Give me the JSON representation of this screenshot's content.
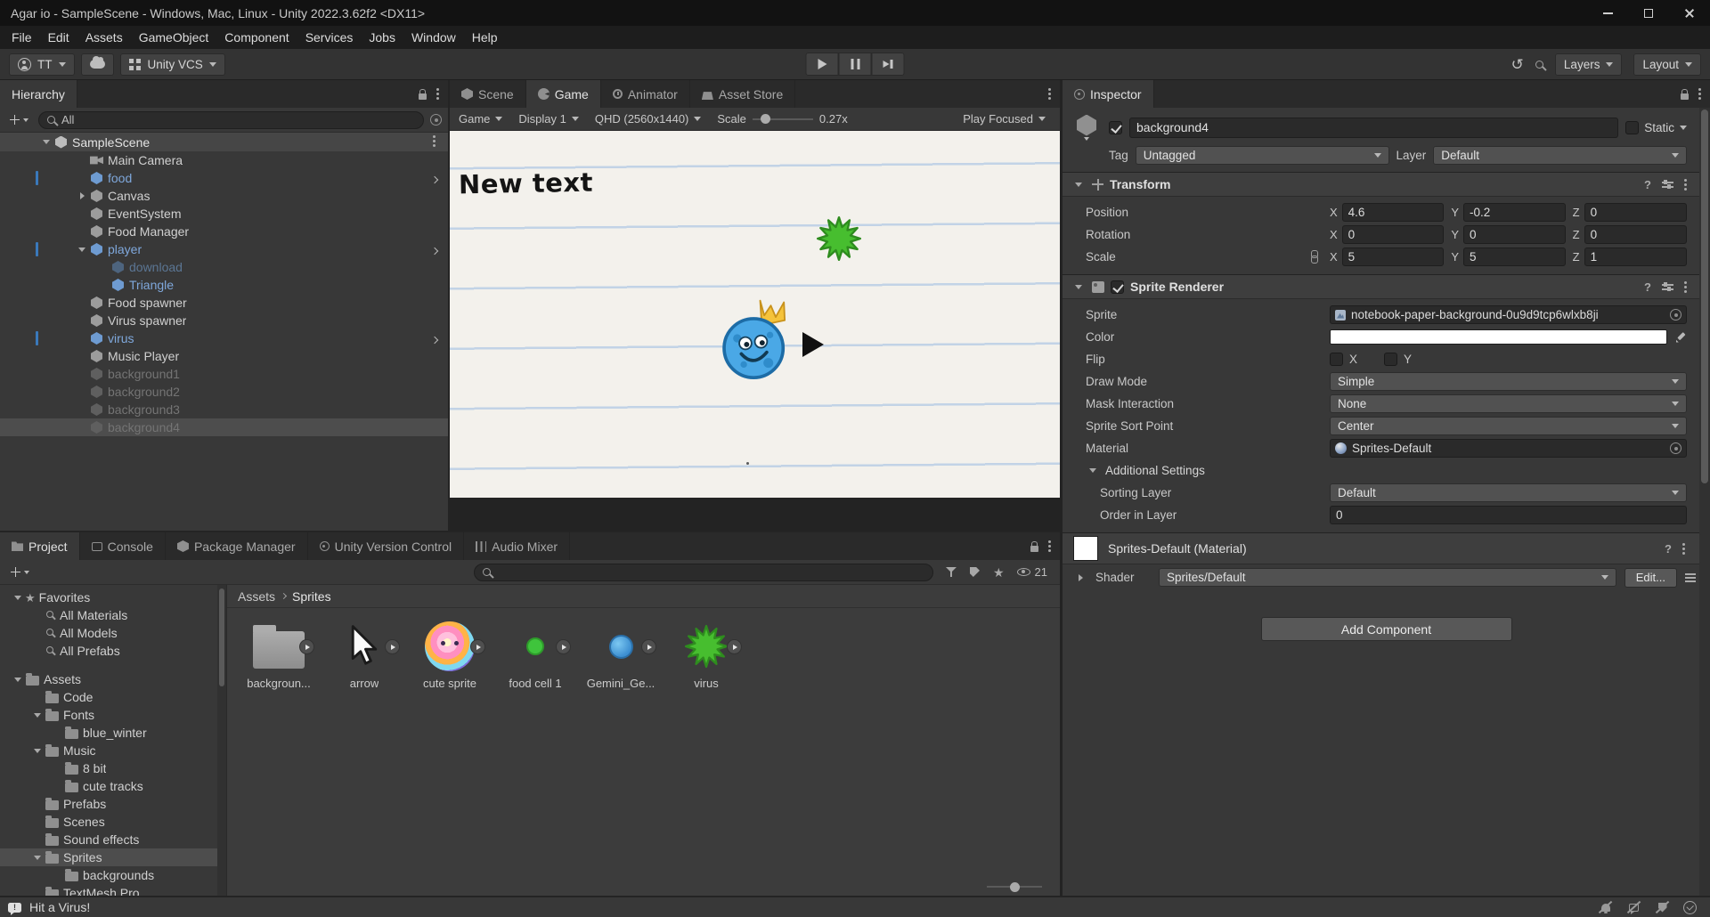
{
  "window": {
    "title": "Agar io - SampleScene - Windows, Mac, Linux - Unity 2022.3.62f2 <DX11>",
    "menus": [
      "File",
      "Edit",
      "Assets",
      "GameObject",
      "Component",
      "Services",
      "Jobs",
      "Window",
      "Help"
    ]
  },
  "toolbar": {
    "account": "TT",
    "vcs": "Unity VCS",
    "layers": "Layers",
    "layout": "Layout"
  },
  "hierarchy": {
    "tab": "Hierarchy",
    "search_value": "All",
    "scene_name": "SampleScene",
    "items": [
      {
        "label": "Main Camera",
        "level": 1,
        "kind": "camera"
      },
      {
        "label": "food",
        "level": 1,
        "kind": "prefab",
        "prefab_chevron": true,
        "accent": true
      },
      {
        "label": "Canvas",
        "level": 1,
        "kind": "go",
        "arrow": "collapsed"
      },
      {
        "label": "EventSystem",
        "level": 1,
        "kind": "go"
      },
      {
        "label": "Food Manager",
        "level": 1,
        "kind": "go"
      },
      {
        "label": "player",
        "level": 1,
        "kind": "prefab",
        "arrow": "expanded",
        "prefab_chevron": true,
        "accent": true
      },
      {
        "label": "download",
        "level": 2,
        "kind": "prefab-disabled"
      },
      {
        "label": "Triangle",
        "level": 2,
        "kind": "prefab"
      },
      {
        "label": "Food spawner",
        "level": 1,
        "kind": "go"
      },
      {
        "label": "Virus spawner",
        "level": 1,
        "kind": "go"
      },
      {
        "label": "virus",
        "level": 1,
        "kind": "prefab",
        "prefab_chevron": true,
        "accent": true
      },
      {
        "label": "Music Player",
        "level": 1,
        "kind": "go"
      },
      {
        "label": "background1",
        "level": 1,
        "kind": "disabled"
      },
      {
        "label": "background2",
        "level": 1,
        "kind": "disabled"
      },
      {
        "label": "background3",
        "level": 1,
        "kind": "disabled"
      },
      {
        "label": "background4",
        "level": 1,
        "kind": "disabled",
        "selected": true
      }
    ]
  },
  "center": {
    "tabs": [
      "Scene",
      "Game",
      "Animator",
      "Asset Store"
    ],
    "active_tab": "Game",
    "game_toolbar": {
      "mode": "Game",
      "display": "Display 1",
      "resolution": "QHD (2560x1440)",
      "scale_label": "Scale",
      "scale_value": "0.27x",
      "play_focused": "Play Focused"
    },
    "game_content": {
      "text": "New text"
    }
  },
  "project": {
    "tabs": [
      "Project",
      "Console",
      "Package Manager",
      "Unity Version Control",
      "Audio Mixer"
    ],
    "active_tab": "Project",
    "hidden_count": "21",
    "favorites_label": "Favorites",
    "favorites": [
      "All Materials",
      "All Models",
      "All Prefabs"
    ],
    "assets_label": "Assets",
    "tree": [
      {
        "label": "Code",
        "level": 1
      },
      {
        "label": "Fonts",
        "level": 1,
        "arrow": "expanded"
      },
      {
        "label": "blue_winter",
        "level": 2
      },
      {
        "label": "Music",
        "level": 1,
        "arrow": "expanded"
      },
      {
        "label": "8 bit",
        "level": 2
      },
      {
        "label": "cute tracks",
        "level": 2
      },
      {
        "label": "Prefabs",
        "level": 1
      },
      {
        "label": "Scenes",
        "level": 1
      },
      {
        "label": "Sound effects",
        "level": 1
      },
      {
        "label": "Sprites",
        "level": 1,
        "arrow": "expanded",
        "selected": true
      },
      {
        "label": "backgrounds",
        "level": 2
      },
      {
        "label": "TextMesh Pro",
        "level": 1
      }
    ],
    "breadcrumb": [
      "Assets",
      "Sprites"
    ],
    "grid": [
      {
        "label": "backgroun...",
        "kind": "folder"
      },
      {
        "label": "arrow",
        "kind": "cursor"
      },
      {
        "label": "cute sprite",
        "kind": "rainbow"
      },
      {
        "label": "food cell 1",
        "kind": "green-dot"
      },
      {
        "label": "Gemini_Ge...",
        "kind": "blue-ball"
      },
      {
        "label": "virus",
        "kind": "splat"
      }
    ]
  },
  "inspector": {
    "tab": "Inspector",
    "go_name": "background4",
    "static_label": "Static",
    "tag_label": "Tag",
    "tag_value": "Untagged",
    "layer_label": "Layer",
    "layer_value": "Default",
    "transform": {
      "title": "Transform",
      "axes": [
        "X",
        "Y",
        "Z"
      ],
      "rows": [
        {
          "label": "Position",
          "x": "4.6",
          "y": "-0.2",
          "z": "0"
        },
        {
          "label": "Rotation",
          "x": "0",
          "y": "0",
          "z": "0"
        },
        {
          "label": "Scale",
          "x": "5",
          "y": "5",
          "z": "1",
          "link": true
        }
      ]
    },
    "sprite_renderer": {
      "title": "Sprite Renderer",
      "sprite_label": "Sprite",
      "sprite_value": "notebook-paper-background-0u9d9tcp6wlxb8ji",
      "color_label": "Color",
      "flip_label": "Flip",
      "flip_x": "X",
      "flip_y": "Y",
      "draw_mode_label": "Draw Mode",
      "draw_mode_value": "Simple",
      "mask_label": "Mask Interaction",
      "mask_value": "None",
      "sort_point_label": "Sprite Sort Point",
      "sort_point_value": "Center",
      "material_label": "Material",
      "material_value": "Sprites-Default",
      "additional_label": "Additional Settings",
      "sorting_layer_label": "Sorting Layer",
      "sorting_layer_value": "Default",
      "order_label": "Order in Layer",
      "order_value": "0"
    },
    "material": {
      "title": "Sprites-Default (Material)",
      "shader_label": "Shader",
      "shader_value": "Sprites/Default",
      "edit_button": "Edit..."
    },
    "add_component": "Add Component"
  },
  "status_bar": {
    "message": "Hit a Virus!"
  },
  "colors": {
    "accent_blue": "#3A79BB",
    "prefab_text": "#7FA8DC",
    "selection_gray": "#4D4D4D",
    "virus_green": "#47BE2F",
    "paper": "#F3F1EC",
    "paper_line": "#C2D3E6"
  }
}
